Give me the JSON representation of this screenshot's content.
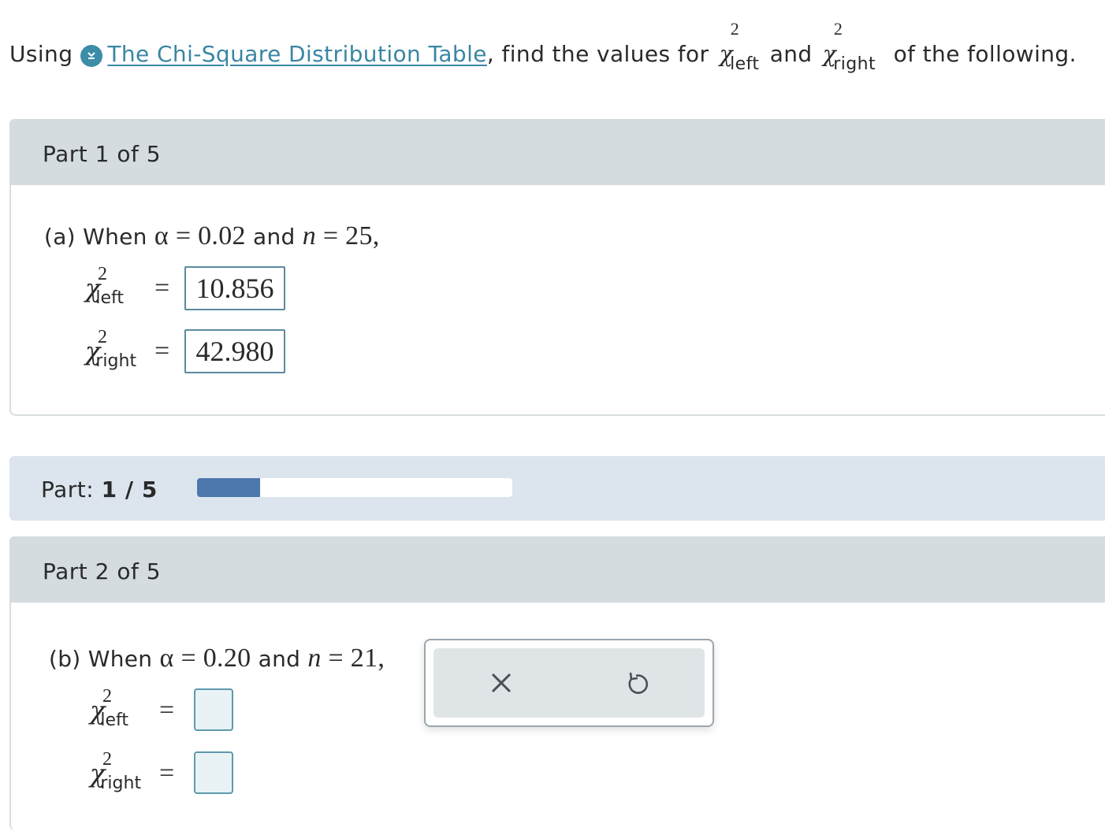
{
  "intro": {
    "prefix": "Using",
    "link_text": "The Chi-Square Distribution Table",
    "mid": ", find the values for",
    "and": "and",
    "suffix": "of the following.",
    "chi_symbol": "χ",
    "exponent": "2",
    "left_sub": "left",
    "right_sub": "right",
    "download_icon": "download-circle-icon"
  },
  "part1": {
    "header": "Part 1 of 5",
    "question_prefix": "(a) When",
    "alpha_expr": "α = 0.02",
    "and": "and",
    "n_var": "n",
    "n_expr": " = 25,",
    "chi_symbol": "χ",
    "exponent": "2",
    "left_sub": "left",
    "right_sub": "right",
    "equals": "=",
    "left_value": "10.856",
    "right_value": "42.980"
  },
  "progress": {
    "label": "Part:",
    "current": "1 / 5",
    "fraction": 0.2,
    "fill_color": "#4c78ae"
  },
  "part2": {
    "header": "Part 2 of 5",
    "question_prefix": "(b) When",
    "alpha_expr": "α = 0.20",
    "and": "and",
    "n_var": "n",
    "n_expr": " = 21,",
    "chi_symbol": "χ",
    "exponent": "2",
    "left_sub": "left",
    "right_sub": "right",
    "equals": "=",
    "left_value": "",
    "right_value": ""
  },
  "tools": {
    "clear_icon": "close-icon",
    "undo_icon": "undo-icon"
  }
}
